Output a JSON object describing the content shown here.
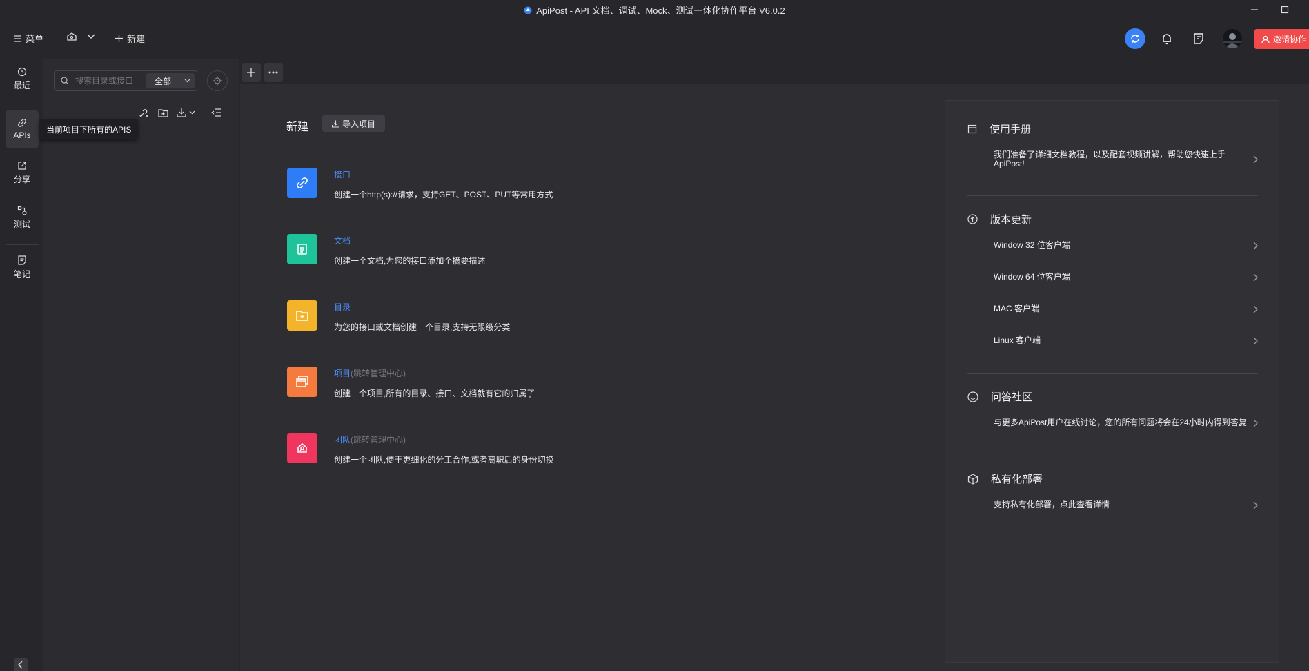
{
  "window": {
    "title": "ApiPost - API 文档、调试、Mock、测试一体化协作平台 V6.0.2",
    "controls": [
      "minimize",
      "maximize"
    ]
  },
  "toolbar": {
    "menu_label": "菜单",
    "new_label": "新建",
    "invite_label": "邀请协作",
    "accent_color": "#f04a4a",
    "sync_color": "#3b82f6"
  },
  "rail": {
    "items": [
      {
        "label": "最近",
        "icon": "history-icon"
      },
      {
        "label": "APIs",
        "icon": "link-icon"
      },
      {
        "label": "分享",
        "icon": "share-icon"
      },
      {
        "label": "测试",
        "icon": "test-icon"
      },
      {
        "label": "笔记",
        "icon": "note-icon"
      }
    ],
    "active": "APIs"
  },
  "tree": {
    "search_placeholder": "搜索目录或接口",
    "scope_value": "全部",
    "tooltip": "当前项目下所有的APIS"
  },
  "main": {
    "heading": "新建",
    "import_label": "导入项目",
    "items": [
      {
        "title": "接口",
        "sub": "",
        "desc": "创建一个http(s)://请求，支持GET、POST、PUT等常用方式",
        "color": "#2f7df6",
        "icon": "plug-icon"
      },
      {
        "title": "文档",
        "sub": "",
        "desc": "创建一个文档,为您的接口添加个摘要描述",
        "color": "#1fc39a",
        "icon": "document-icon"
      },
      {
        "title": "目录",
        "sub": "",
        "desc": "为您的接口或文档创建一个目录,支持无限级分类",
        "color": "#f3b42c",
        "icon": "folder-add-icon"
      },
      {
        "title": "项目",
        "sub": "(跳转管理中心)",
        "desc": "创建一个项目,所有的目录、接口、文档就有它的归属了",
        "color": "#f47a3e",
        "icon": "project-icon"
      },
      {
        "title": "团队",
        "sub": "(跳转管理中心)",
        "desc": "创建一个团队,便于更细化的分工合作,或者离职后的身份切换",
        "color": "#f0365e",
        "icon": "team-icon"
      }
    ]
  },
  "side": {
    "manual": {
      "title": "使用手册",
      "desc": "我们准备了详细文档教程，以及配套视频讲解，帮助您快速上手ApiPost!"
    },
    "updates": {
      "title": "版本更新",
      "items": [
        "Window 32 位客户端",
        "Window 64 位客户端",
        "MAC 客户端",
        "Linux 客户端"
      ]
    },
    "community": {
      "title": "问答社区",
      "desc": "与更多ApiPost用户在线讨论，您的所有问题将会在24小时内得到答复"
    },
    "private": {
      "title": "私有化部署",
      "desc": "支持私有化部署，点此查看详情"
    }
  }
}
